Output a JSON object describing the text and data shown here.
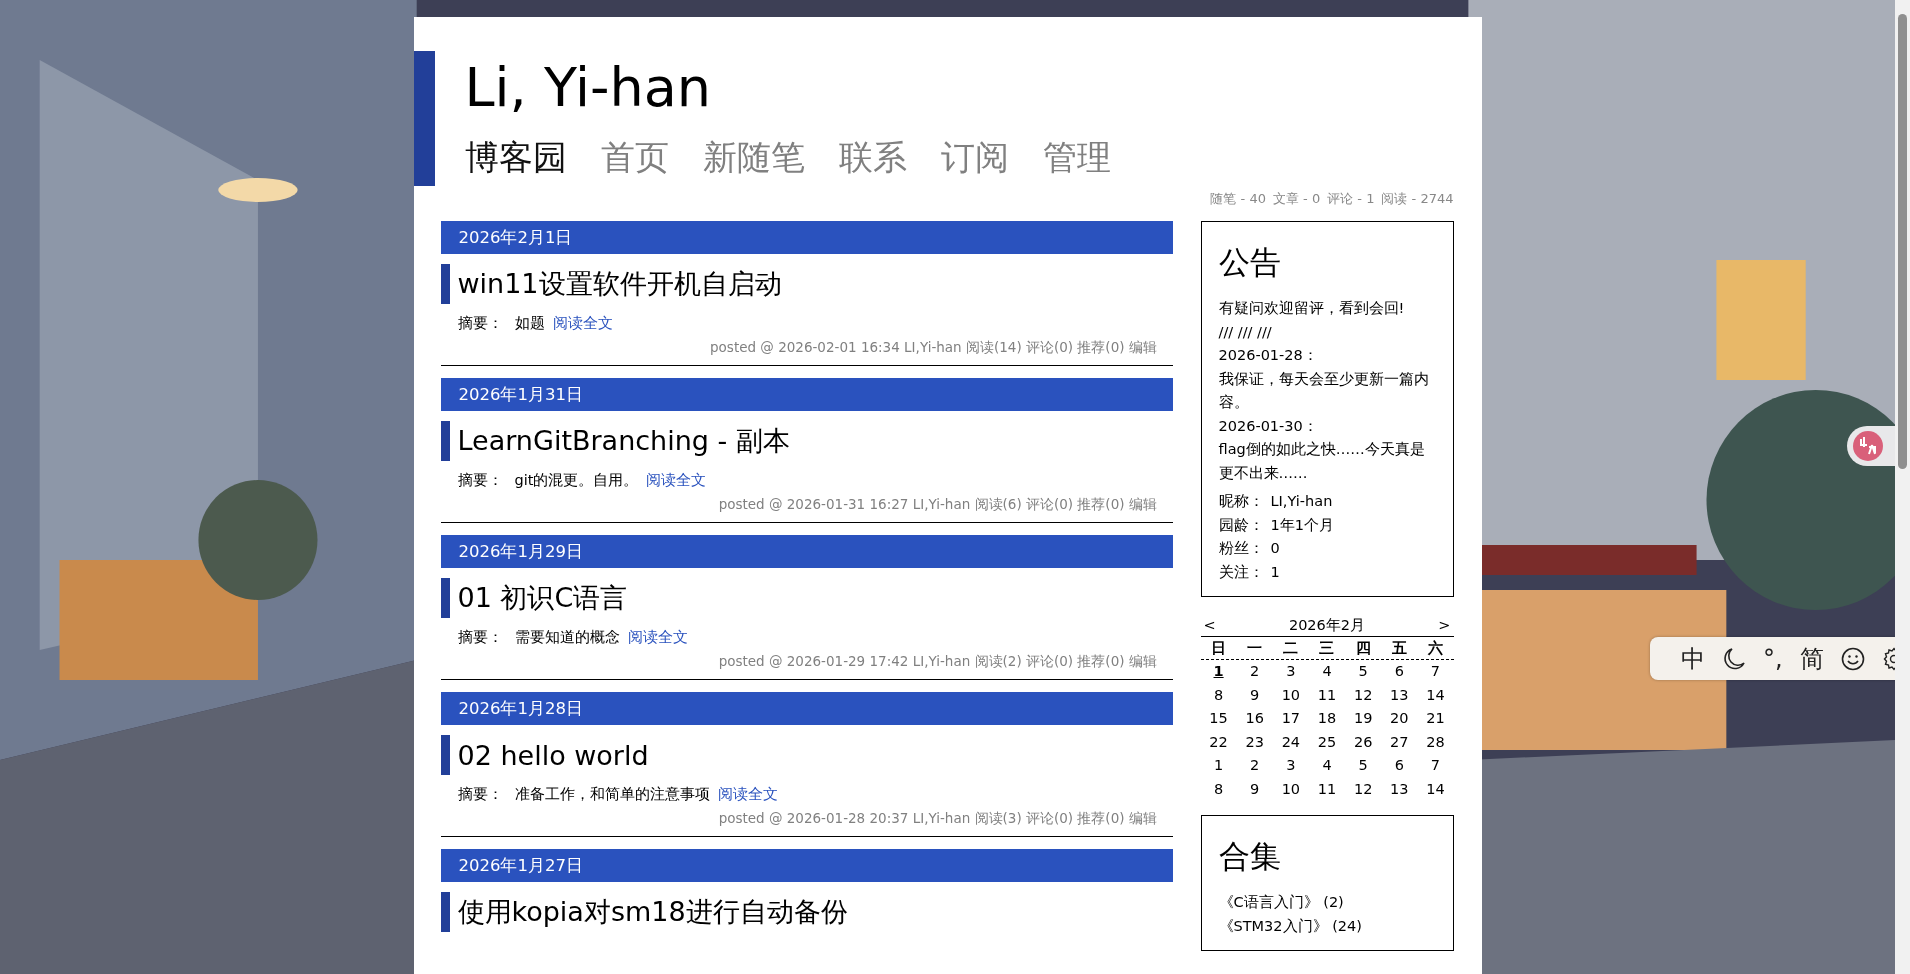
{
  "blog_title": "Li, Yi-han",
  "nav": [
    {
      "label": "博客园",
      "kind": "site"
    },
    {
      "label": "首页",
      "kind": "link"
    },
    {
      "label": "新随笔",
      "kind": "link"
    },
    {
      "label": "联系",
      "kind": "link"
    },
    {
      "label": "订阅",
      "kind": "link"
    },
    {
      "label": "管理",
      "kind": "link"
    }
  ],
  "stats": [
    "随笔 - 40",
    "文章 - 0",
    "评论 - 1",
    "阅读 - 2744"
  ],
  "posts": [
    {
      "date": "2026年2月1日",
      "title": "win11设置软件开机自启动",
      "summary_label": "摘要：",
      "summary": "如题",
      "read_more": "阅读全文",
      "footer": "posted @ 2026-02-01 16:34 LI,Yi-han 阅读(14) 评论(0) 推荐(0)",
      "edit": "编辑"
    },
    {
      "date": "2026年1月31日",
      "title": "LearnGitBranching - 副本",
      "summary_label": "摘要：",
      "summary": "git的混更。自用。",
      "read_more": "阅读全文",
      "footer": "posted @ 2026-01-31 16:27 LI,Yi-han 阅读(6) 评论(0) 推荐(0)",
      "edit": "编辑"
    },
    {
      "date": "2026年1月29日",
      "title": "01 初识C语言",
      "summary_label": "摘要：",
      "summary": "需要知道的概念",
      "read_more": "阅读全文",
      "footer": "posted @ 2026-01-29 17:42 LI,Yi-han 阅读(2) 评论(0) 推荐(0)",
      "edit": "编辑"
    },
    {
      "date": "2026年1月28日",
      "title": "02 hello world",
      "summary_label": "摘要：",
      "summary": "准备工作，和简单的注意事项",
      "read_more": "阅读全文",
      "footer": "posted @ 2026-01-28 20:37 LI,Yi-han 阅读(3) 评论(0) 推荐(0)",
      "edit": "编辑"
    },
    {
      "date": "2026年1月27日",
      "title": "使用kopia对sm18进行自动备份"
    }
  ],
  "notice": {
    "title": "公告",
    "lines": [
      "有疑问欢迎留评，看到会回!",
      "/// /// ///",
      "2026-01-28：",
      "我保证，每天会至少更新一篇内容。",
      "2026-01-30：",
      "flag倒的如此之快……今天真是更不出来……"
    ],
    "profile": [
      {
        "label": "昵称：",
        "value": "LI,Yi-han"
      },
      {
        "label": "园龄：",
        "value": "1年1个月"
      },
      {
        "label": "粉丝：",
        "value": "0"
      },
      {
        "label": "关注：",
        "value": "1"
      }
    ]
  },
  "calendar": {
    "prev": "<",
    "month": "2026年2月",
    "next": ">",
    "weekdays": [
      "日",
      "一",
      "二",
      "三",
      "四",
      "五",
      "六"
    ],
    "weeks": [
      [
        {
          "day": "1",
          "today": true
        },
        {
          "day": "2",
          "today": false
        },
        {
          "day": "3",
          "today": false
        },
        {
          "day": "4",
          "today": false
        },
        {
          "day": "5",
          "today": false
        },
        {
          "day": "6",
          "today": false
        },
        {
          "day": "7",
          "today": false
        }
      ],
      [
        {
          "day": "8",
          "today": false
        },
        {
          "day": "9",
          "today": false
        },
        {
          "day": "10",
          "today": false
        },
        {
          "day": "11",
          "today": false
        },
        {
          "day": "12",
          "today": false
        },
        {
          "day": "13",
          "today": false
        },
        {
          "day": "14",
          "today": false
        }
      ],
      [
        {
          "day": "15",
          "today": false
        },
        {
          "day": "16",
          "today": false
        },
        {
          "day": "17",
          "today": false
        },
        {
          "day": "18",
          "today": false
        },
        {
          "day": "19",
          "today": false
        },
        {
          "day": "20",
          "today": false
        },
        {
          "day": "21",
          "today": false
        }
      ],
      [
        {
          "day": "22",
          "today": false
        },
        {
          "day": "23",
          "today": false
        },
        {
          "day": "24",
          "today": false
        },
        {
          "day": "25",
          "today": false
        },
        {
          "day": "26",
          "today": false
        },
        {
          "day": "27",
          "today": false
        },
        {
          "day": "28",
          "today": false
        }
      ],
      [
        {
          "day": "1",
          "today": false
        },
        {
          "day": "2",
          "today": false
        },
        {
          "day": "3",
          "today": false
        },
        {
          "day": "4",
          "today": false
        },
        {
          "day": "5",
          "today": false
        },
        {
          "day": "6",
          "today": false
        },
        {
          "day": "7",
          "today": false
        }
      ],
      [
        {
          "day": "8",
          "today": false
        },
        {
          "day": "9",
          "today": false
        },
        {
          "day": "10",
          "today": false
        },
        {
          "day": "11",
          "today": false
        },
        {
          "day": "12",
          "today": false
        },
        {
          "day": "13",
          "today": false
        },
        {
          "day": "14",
          "today": false
        }
      ]
    ]
  },
  "collections": {
    "title": "合集",
    "items": [
      "《C语言入门》 (2)",
      "《STM32入门》 (24)"
    ]
  },
  "ime_toolbar": {
    "items": [
      {
        "kind": "text",
        "label": "中"
      },
      {
        "kind": "moon"
      },
      {
        "kind": "text",
        "label": "°,"
      },
      {
        "kind": "text",
        "label": "简"
      },
      {
        "kind": "smile"
      },
      {
        "kind": "gear"
      }
    ]
  }
}
